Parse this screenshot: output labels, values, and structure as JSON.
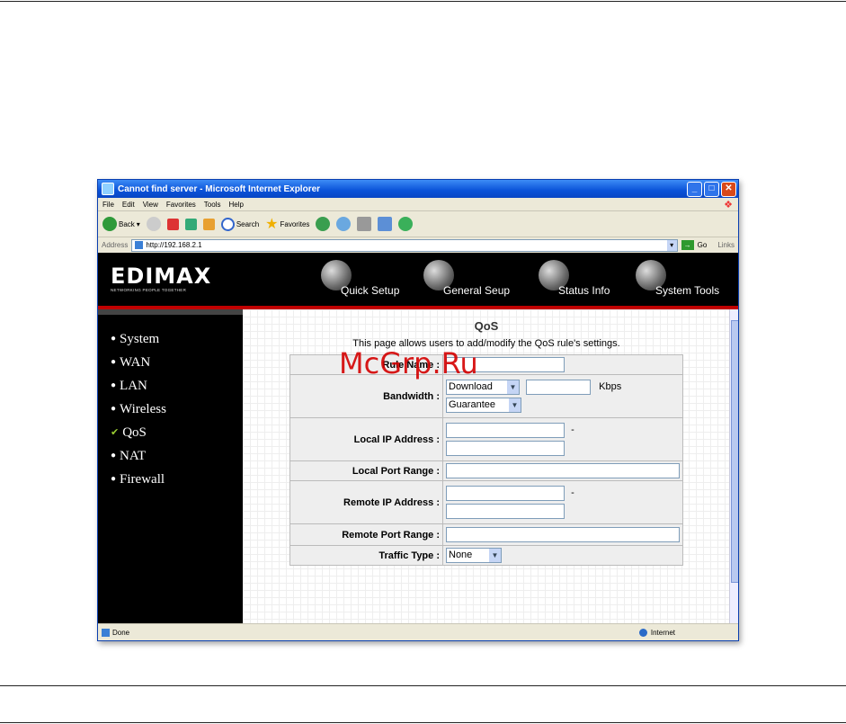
{
  "window": {
    "title": "Cannot find server - Microsoft Internet Explorer",
    "menu": [
      "File",
      "Edit",
      "View",
      "Favorites",
      "Tools",
      "Help"
    ],
    "toolbar": {
      "back": "Back",
      "search": "Search",
      "favorites": "Favorites"
    },
    "address_label": "Address",
    "address": "http://192.168.2.1",
    "go": "Go",
    "links": "Links",
    "status_left": "Done",
    "status_right": "Internet"
  },
  "header": {
    "logo": "EDIMAX",
    "tagline": "NETWORKING PEOPLE TOGETHER",
    "nav": [
      "Quick Setup",
      "General Seup",
      "Status Info",
      "System Tools"
    ]
  },
  "sidebar": {
    "items": [
      "System",
      "WAN",
      "LAN",
      "Wireless",
      "QoS",
      "NAT",
      "Firewall"
    ]
  },
  "page": {
    "title": "QoS",
    "description": "This page allows users to add/modify the QoS rule's settings."
  },
  "form": {
    "rule_name": "Rule Name :",
    "bandwidth": "Bandwidth :",
    "bandwidth_direction": "Download",
    "bandwidth_unit": "Kbps",
    "bandwidth_type": "Guarantee",
    "local_ip": "Local IP Address :",
    "local_port": "Local Port Range :",
    "remote_ip": "Remote IP Address :",
    "remote_port": "Remote Port Range :",
    "traffic_type": "Traffic Type :",
    "traffic_type_value": "None",
    "dash": "-"
  },
  "watermark": "McGrp.Ru"
}
